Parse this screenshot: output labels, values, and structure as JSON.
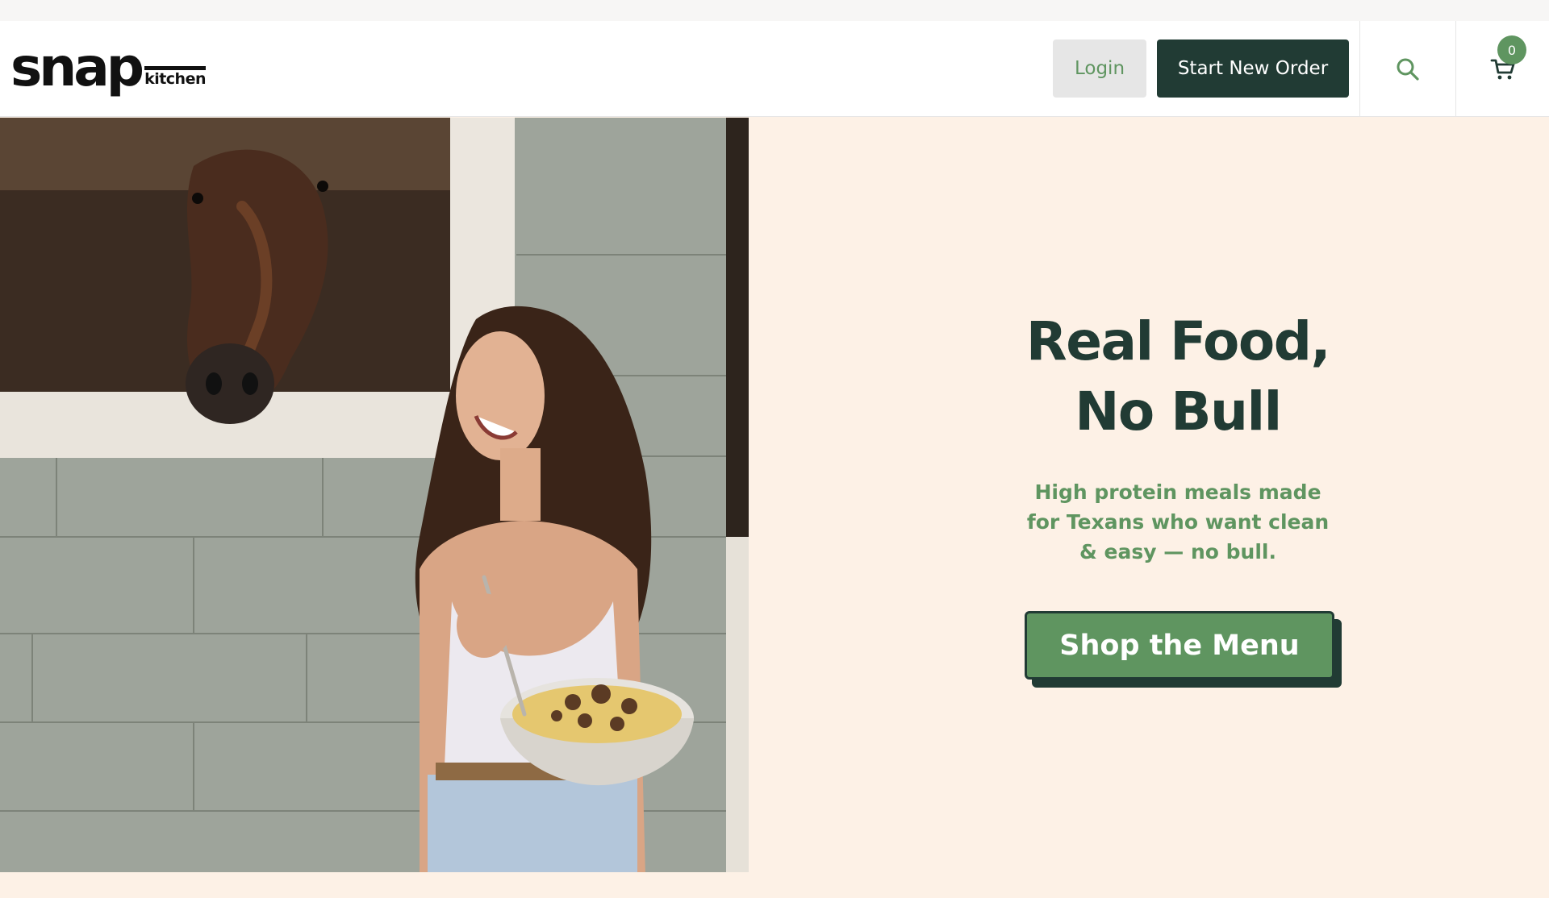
{
  "header": {
    "logo_main": "snap",
    "logo_sub": "kitchen",
    "login_label": "Login",
    "order_label": "Start New Order",
    "cart_count": "0"
  },
  "hero": {
    "title_line1": "Real Food,",
    "title_line2": "No Bull",
    "subtitle": "High protein meals made for Texans who want clean & easy — no bull.",
    "cta_label": "Shop the Menu",
    "image_alt": "Woman holding a bowl of pasta next to a horse in a stable"
  },
  "colors": {
    "dark_green": "#213b34",
    "accent_green": "#5f9560",
    "cream_bg": "#fdf1e6"
  },
  "icons": [
    "search-icon",
    "cart-icon"
  ]
}
